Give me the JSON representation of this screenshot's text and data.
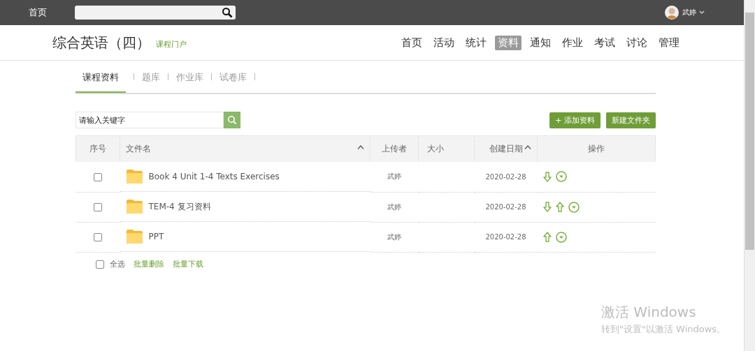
{
  "topbar": {
    "home": "首页",
    "user": "武婷"
  },
  "course": {
    "title": "综合英语（四）",
    "portal": "课程门户"
  },
  "nav": [
    {
      "label": "首页",
      "selected": false
    },
    {
      "label": "活动",
      "selected": false
    },
    {
      "label": "统计",
      "selected": false
    },
    {
      "label": "资料",
      "selected": true
    },
    {
      "label": "通知",
      "selected": false
    },
    {
      "label": "作业",
      "selected": false
    },
    {
      "label": "考试",
      "selected": false
    },
    {
      "label": "讨论",
      "selected": false
    },
    {
      "label": "管理",
      "selected": false
    }
  ],
  "tabs": [
    {
      "label": "课程资料",
      "selected": true
    },
    {
      "label": "题库",
      "selected": false
    },
    {
      "label": "作业库",
      "selected": false
    },
    {
      "label": "试卷库",
      "selected": false
    }
  ],
  "keyword_search": {
    "placeholder": "请输入关键字"
  },
  "buttons": [
    "+ 添加资料",
    "新建文件夹"
  ],
  "table": {
    "columns": [
      {
        "label": "序号",
        "sortable": false
      },
      {
        "label": "文件名",
        "sortable": true
      },
      {
        "label": "上传者",
        "sortable": false
      },
      {
        "label": "大小",
        "sortable": false
      },
      {
        "label": "创建日期",
        "sortable": true
      },
      {
        "label": "操作",
        "sortable": false
      }
    ],
    "rows": [
      {
        "checked": false,
        "name": "Book 4 Unit 1-4 Texts Exercises",
        "uploader": "武婷",
        "date": "2020-02-28",
        "actions": [
          {
            "kind": "down"
          },
          {
            "kind": "menu"
          }
        ]
      },
      {
        "checked": false,
        "name": "TEM-4 复习资料",
        "uploader": "武婷",
        "date": "2020-02-28",
        "actions": [
          {
            "kind": "down"
          },
          {
            "kind": "up"
          },
          {
            "kind": "menu"
          }
        ]
      },
      {
        "checked": false,
        "name": "PPT",
        "uploader": "武婷",
        "date": "2020-02-28",
        "actions": [
          {
            "kind": "up"
          },
          {
            "kind": "menu"
          }
        ]
      }
    ]
  },
  "footer": {
    "select_all": {
      "label": "全选",
      "checked": false
    },
    "links": [
      "批量删除",
      "批量下载"
    ]
  },
  "os_notice": {
    "title": "激活 Windows",
    "text": "转到\"设置\"以激活 Windows。"
  }
}
